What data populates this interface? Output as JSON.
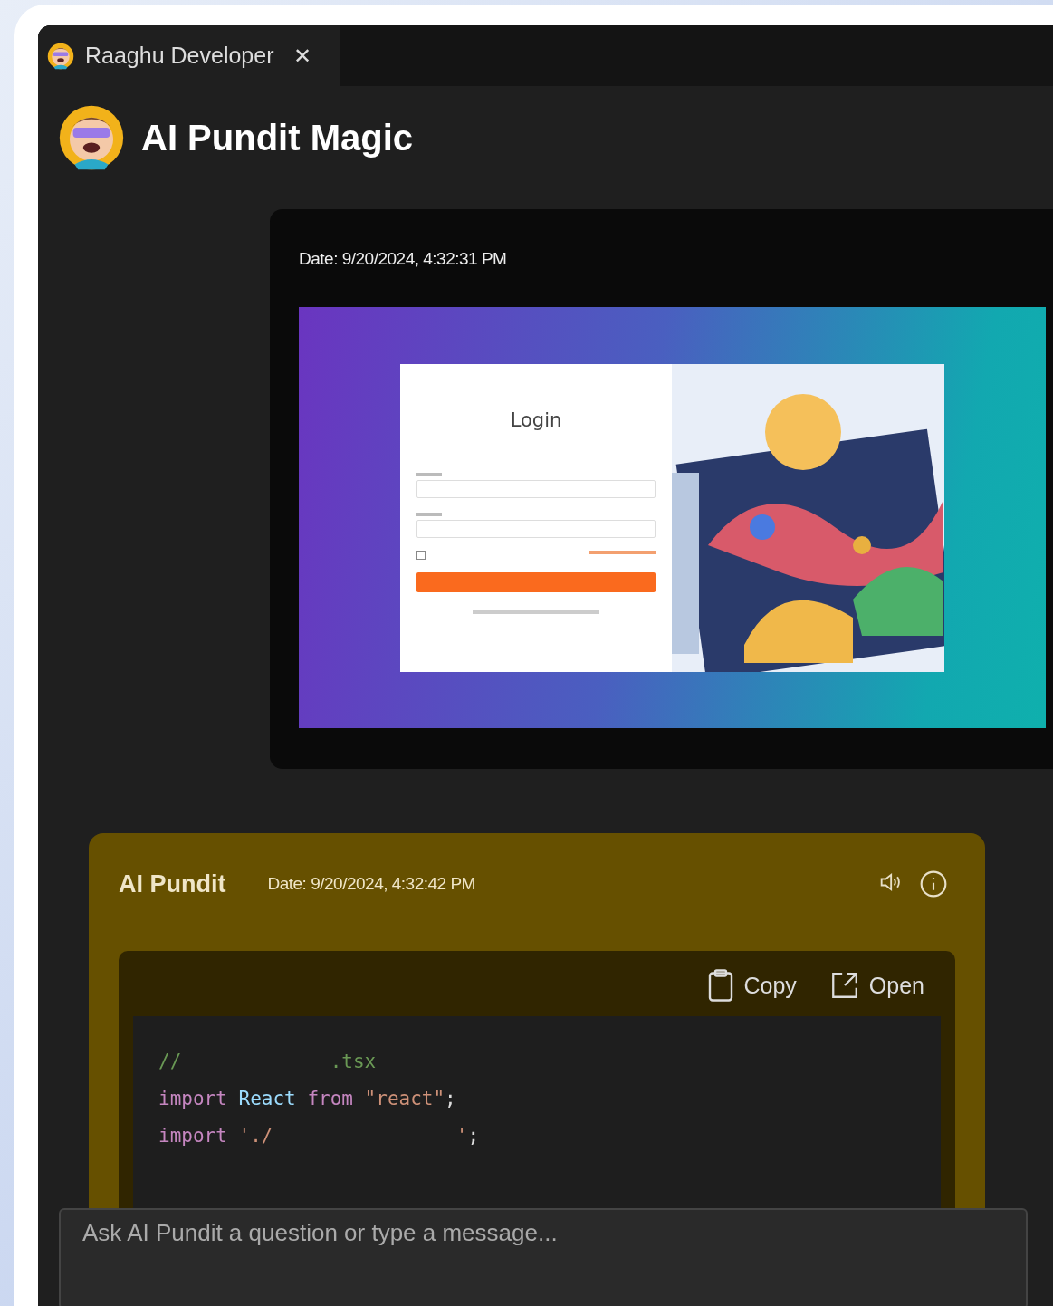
{
  "tab": {
    "title": "Raaghu Developer",
    "close": "✕"
  },
  "header": {
    "title": "AI Pundit Magic"
  },
  "user_message": {
    "date": "Date: 9/20/2024, 4:32:31 PM",
    "attachment": {
      "login_title": "Login"
    }
  },
  "ai_message": {
    "sender": "AI Pundit",
    "date": "Date: 9/20/2024, 4:32:42 PM",
    "code_actions": [
      {
        "kind": "copy",
        "label": "Copy"
      },
      {
        "kind": "open",
        "label": "Open"
      }
    ],
    "code_lines": [
      [
        {
          "kind": "comment",
          "text": "//             .tsx"
        }
      ],
      [
        {
          "kind": "keyword",
          "text": "import "
        },
        {
          "kind": "name",
          "text": "React "
        },
        {
          "kind": "keyword",
          "text": "from "
        },
        {
          "kind": "string",
          "text": "\"react\""
        },
        {
          "kind": "plain",
          "text": ";"
        }
      ],
      [
        {
          "kind": "keyword",
          "text": "import "
        },
        {
          "kind": "string",
          "text": "'./                '"
        },
        {
          "kind": "plain",
          "text": ";"
        }
      ]
    ]
  },
  "composer": {
    "placeholder": "Ask AI Pundit a question or type a message..."
  }
}
